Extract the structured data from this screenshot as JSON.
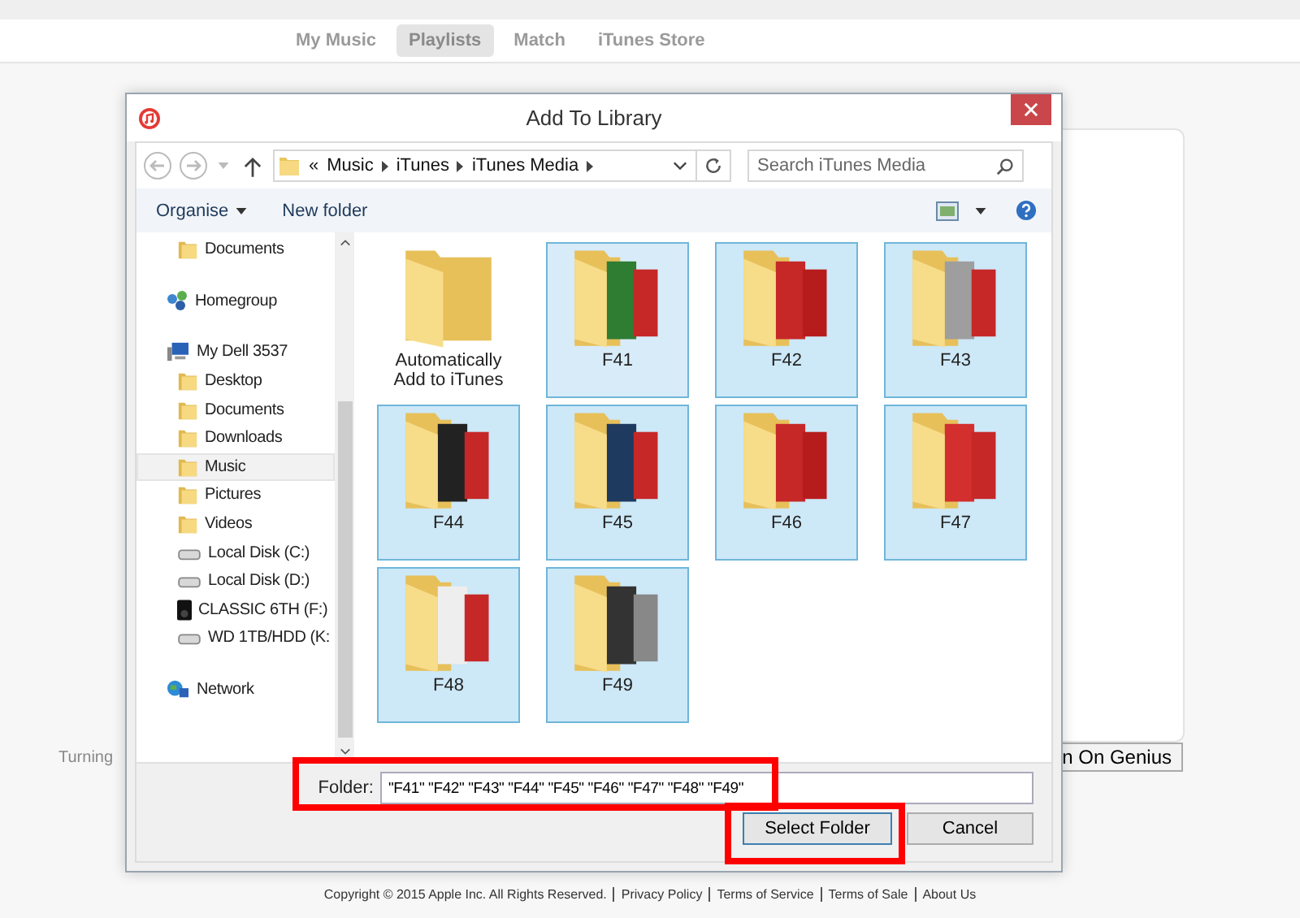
{
  "nav": {
    "tabs": [
      {
        "label": "My Music",
        "selected": false
      },
      {
        "label": "Playlists",
        "selected": true
      },
      {
        "label": "Match",
        "selected": false
      },
      {
        "label": "iTunes Store",
        "selected": false
      }
    ]
  },
  "behind": {
    "note": "Turning",
    "button": "n On Genius"
  },
  "dialog": {
    "title": "Add To Library",
    "address": {
      "overflow_mark": "«",
      "crumbs": [
        "Music",
        "iTunes",
        "iTunes Media"
      ]
    },
    "search": {
      "placeholder": "Search iTunes Media"
    },
    "toolbar": {
      "organise": "Organise",
      "new_folder": "New folder"
    },
    "sidebar": {
      "items": [
        {
          "label": "Documents",
          "kind": "folder",
          "selected": false
        },
        {
          "label": "Homegroup",
          "kind": "homegroup",
          "selected": false
        },
        {
          "label": "My Dell 3537",
          "kind": "computer",
          "selected": false,
          "children": [
            {
              "label": "Desktop",
              "kind": "folder",
              "selected": false
            },
            {
              "label": "Documents",
              "kind": "folder",
              "selected": false
            },
            {
              "label": "Downloads",
              "kind": "folder",
              "selected": false
            },
            {
              "label": "Music",
              "kind": "folder",
              "selected": true
            },
            {
              "label": "Pictures",
              "kind": "folder",
              "selected": false
            },
            {
              "label": "Videos",
              "kind": "folder",
              "selected": false
            },
            {
              "label": "Local Disk (C:)",
              "kind": "drive",
              "selected": false
            },
            {
              "label": "Local Disk (D:)",
              "kind": "drive",
              "selected": false
            },
            {
              "label": "CLASSIC 6TH (F:)",
              "kind": "player",
              "selected": false
            },
            {
              "label": "WD 1TB/HDD (K:",
              "kind": "drive",
              "selected": false
            }
          ]
        },
        {
          "label": "Network",
          "kind": "network",
          "selected": false
        }
      ]
    },
    "files": [
      {
        "name": "Automatically Add to iTunes",
        "kind": "plain",
        "selected": false
      },
      {
        "name": "F41",
        "kind": "album",
        "selected": true
      },
      {
        "name": "F42",
        "kind": "album",
        "selected": true
      },
      {
        "name": "F43",
        "kind": "album",
        "selected": true
      },
      {
        "name": "F44",
        "kind": "album",
        "selected": true
      },
      {
        "name": "F45",
        "kind": "album",
        "selected": true
      },
      {
        "name": "F46",
        "kind": "album",
        "selected": true
      },
      {
        "name": "F47",
        "kind": "album",
        "selected": true
      },
      {
        "name": "F48",
        "kind": "album",
        "selected": true
      },
      {
        "name": "F49",
        "kind": "album",
        "selected": true
      }
    ],
    "folder_label": "Folder:",
    "folder_value": "\"F41\" \"F42\" \"F43\" \"F44\" \"F45\" \"F46\" \"F47\" \"F48\" \"F49\"",
    "buttons": [
      "Select Folder",
      "Cancel"
    ]
  },
  "footer": {
    "copyright": "Copyright  ©  2015 Apple Inc.  All Rights Reserved.",
    "links": [
      "Privacy Policy",
      "Terms of Service",
      "Terms of Sale",
      "About Us"
    ]
  }
}
